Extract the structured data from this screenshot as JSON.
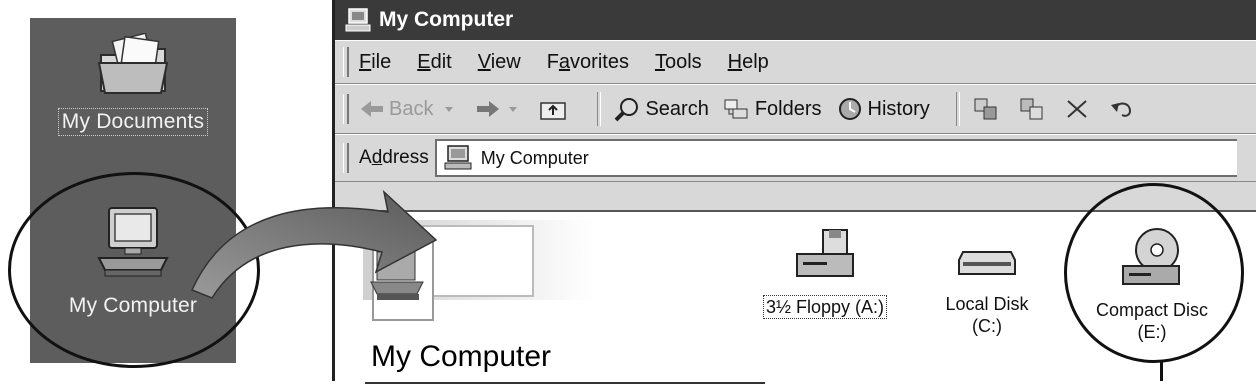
{
  "desktop": {
    "icons": [
      {
        "label": "My Documents",
        "icon": "folder-documents-icon"
      },
      {
        "label": "My Computer",
        "icon": "computer-icon"
      }
    ]
  },
  "window": {
    "title": "My Computer",
    "menu": [
      {
        "underline": "F",
        "rest": "ile"
      },
      {
        "underline": "E",
        "rest": "dit"
      },
      {
        "underline": "V",
        "rest": "iew"
      },
      {
        "pre": "F",
        "underline": "a",
        "rest": "vorites"
      },
      {
        "underline": "T",
        "rest": "ools"
      },
      {
        "underline": "H",
        "rest": "elp"
      }
    ],
    "toolbar": {
      "back": "Back",
      "search": "Search",
      "folders": "Folders",
      "history": "History"
    },
    "address": {
      "label_pre": "A",
      "label_u": "d",
      "label_rest": "dress",
      "value": "My Computer"
    },
    "content": {
      "page_title": "My Computer",
      "drives": [
        {
          "line1": "3½ Floppy (A:)",
          "line2": "",
          "icon": "floppy-drive-icon"
        },
        {
          "line1": "Local Disk",
          "line2": "(C:)",
          "icon": "hard-disk-icon"
        },
        {
          "line1": "Compact Disc",
          "line2": "(E:)",
          "icon": "compact-disc-icon"
        }
      ]
    }
  },
  "colors": {
    "desktop_bg": "#5d5d5d",
    "titlebar_bg": "#3a3a3a",
    "chrome_bg": "#d8d8d8"
  }
}
